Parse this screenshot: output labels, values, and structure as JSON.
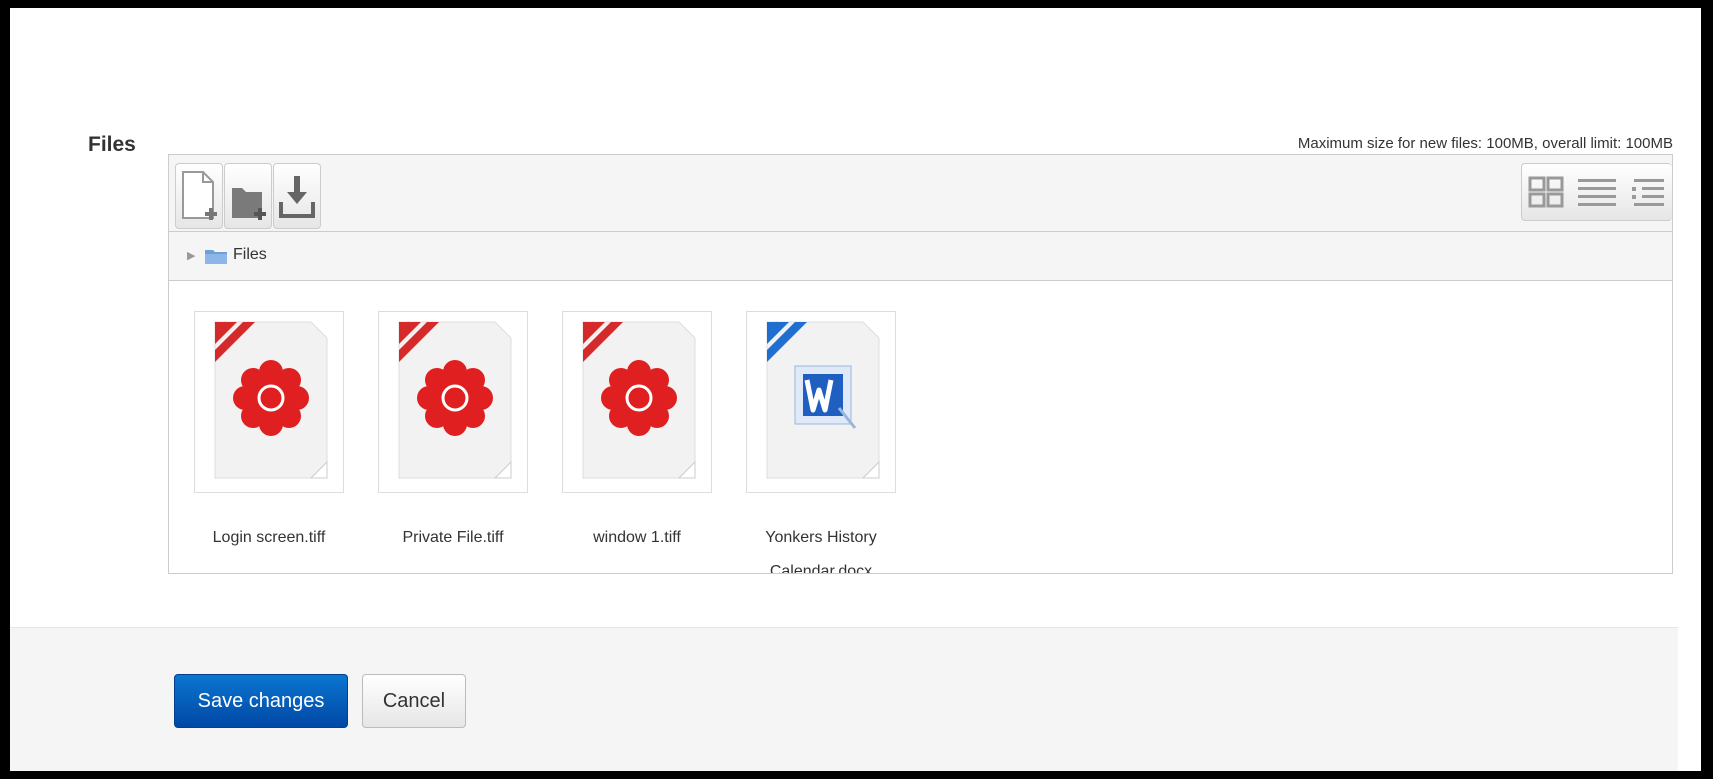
{
  "form": {
    "field_label": "Files",
    "max_size_text": "Maximum size for new files: 100MB, overall limit: 100MB"
  },
  "toolbar": {
    "buttons": [
      {
        "icon": "add-file-icon"
      },
      {
        "icon": "create-folder-icon"
      },
      {
        "icon": "download-icon"
      }
    ],
    "views": [
      {
        "icon": "view-icons-icon",
        "active": true
      },
      {
        "icon": "view-details-icon"
      },
      {
        "icon": "view-tree-icon"
      }
    ]
  },
  "path": {
    "label": "Files"
  },
  "files": [
    {
      "name": "Login screen.tiff",
      "type": "image",
      "ribbon": "#d62a2a"
    },
    {
      "name": "Private File.tiff",
      "type": "image",
      "ribbon": "#d62a2a"
    },
    {
      "name": "window 1.tiff",
      "type": "image",
      "ribbon": "#d62a2a"
    },
    {
      "name": "Yonkers History Calendar.docx",
      "type": "document",
      "ribbon": "#1f6fd0"
    }
  ],
  "actions": {
    "save_label": "Save changes",
    "cancel_label": "Cancel"
  },
  "colors": {
    "primary": "#0b6fc7",
    "image_icon": "#e02020",
    "word_icon": "#1f5fbf"
  }
}
